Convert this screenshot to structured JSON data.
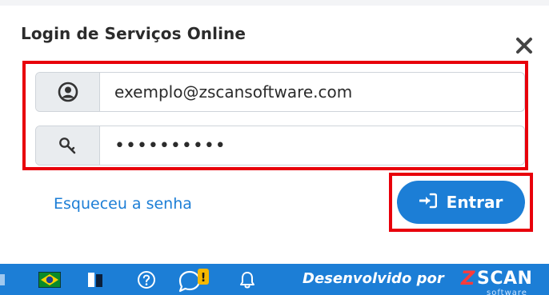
{
  "dialog": {
    "title": "Login de Serviços Online",
    "close_icon": "close-icon"
  },
  "login": {
    "email_value": "exemplo@zscansoftware.com",
    "password_value": "••••••••••",
    "user_icon": "user-circle-icon",
    "key_icon": "key-icon"
  },
  "actions": {
    "forgot_label": "Esqueceu a senha",
    "enter_label": "Entrar",
    "enter_icon": "sign-in-icon"
  },
  "taskbar": {
    "icons": [
      "brazil-flag-icon",
      "device-icon",
      "help-icon",
      "chat-alert-icon",
      "bell-icon"
    ],
    "alert_badge": "!",
    "developed_by": "Desenvolvido por",
    "logo_z": "Z",
    "logo_scan": "SCAN",
    "logo_sub": "software"
  },
  "colors": {
    "primary": "#1c7ed6",
    "highlight": "#e8000b",
    "badge": "#f5b800"
  }
}
